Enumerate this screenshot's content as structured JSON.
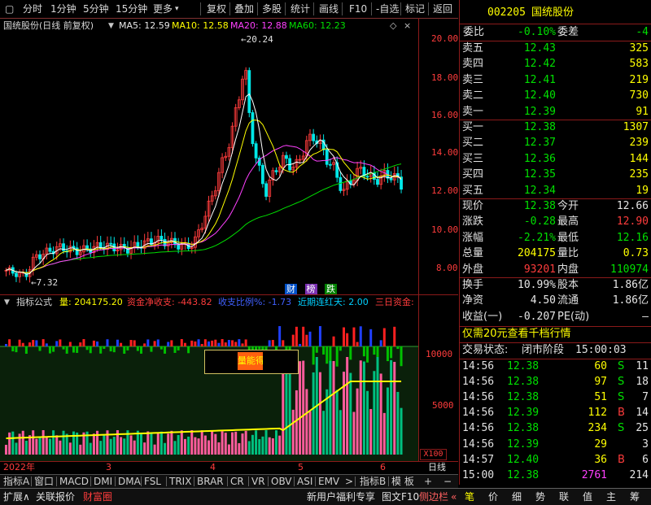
{
  "toolbar": {
    "items": [
      "分时",
      "1分钟",
      "5分钟",
      "15分钟",
      "更多",
      "复权",
      "叠加",
      "多股",
      "统计",
      "画线",
      "F10",
      "-自选",
      "标记",
      "返回"
    ],
    "more_arrow": "▾"
  },
  "price_chart": {
    "title": "国统股份(日线 前复权)",
    "ma5": "MA5: 12.59",
    "ma10": "MA10: 12.58",
    "ma20": "MA20: 12.88",
    "ma60": "MA60: 12.23",
    "high_label": "20.24",
    "low_label": "7.32",
    "y_ticks": [
      "20.00",
      "18.00",
      "16.00",
      "14.00",
      "12.00",
      "10.00",
      "8.00"
    ],
    "badges": [
      "财",
      "榜",
      "跌"
    ],
    "colors": {
      "ma5": "#ffffff",
      "ma10": "#ffff00",
      "ma20": "#ff40ff",
      "ma60": "#00e000",
      "up": "#ff3c3c",
      "down": "#00e8e8"
    }
  },
  "indicator": {
    "title": "指标公式",
    "vol": "量: 204175.20",
    "net": "资金净收支: -443.82",
    "ratio": "收支比例%: -1.73",
    "streak": "近期连红天: 2.00",
    "three_day": "三日资金:",
    "box_label": "量能得",
    "y_ticks": [
      "10000",
      "5000"
    ],
    "scale": "X100"
  },
  "x_axis": {
    "labels": [
      "2022年",
      "3",
      "4",
      "5",
      "6"
    ],
    "period": "日线"
  },
  "tabs": {
    "items": [
      "指标A",
      "窗口",
      "MACD",
      "DMI",
      "DMA",
      "FSL",
      "TRIX",
      "BRAR",
      "CR",
      "VR",
      "OBV",
      "ASI",
      "EMV"
    ],
    "more": ">",
    "right": [
      "指标B",
      "模 板",
      "+",
      "−"
    ]
  },
  "status": {
    "left": [
      "扩展∧",
      "关联报价",
      "财富圈"
    ],
    "mid": [
      "新用户福利专享",
      "图文F10",
      "侧边栏"
    ],
    "tabs": [
      "笔",
      "价",
      "细",
      "势",
      "联",
      "值",
      "主",
      "筹"
    ]
  },
  "quote": {
    "code": "002205",
    "name": "国统股份",
    "wei_bi_label": "委比",
    "wei_bi": "-0.10%",
    "wei_cha_label": "委差",
    "wei_cha": "-4",
    "asks": [
      {
        "label": "卖五",
        "price": "12.43",
        "vol": "325"
      },
      {
        "label": "卖四",
        "price": "12.42",
        "vol": "583"
      },
      {
        "label": "卖三",
        "price": "12.41",
        "vol": "219"
      },
      {
        "label": "卖二",
        "price": "12.40",
        "vol": "730"
      },
      {
        "label": "卖一",
        "price": "12.39",
        "vol": "91"
      }
    ],
    "bids": [
      {
        "label": "买一",
        "price": "12.38",
        "vol": "1307"
      },
      {
        "label": "买二",
        "price": "12.37",
        "vol": "239"
      },
      {
        "label": "买三",
        "price": "12.36",
        "vol": "144"
      },
      {
        "label": "买四",
        "price": "12.35",
        "vol": "235"
      },
      {
        "label": "买五",
        "price": "12.34",
        "vol": "19"
      }
    ],
    "stats": [
      {
        "l1": "现价",
        "v1": "12.38",
        "l2": "今开",
        "v2": "12.66",
        "c1": "green",
        "c2": "white"
      },
      {
        "l1": "涨跌",
        "v1": "-0.28",
        "l2": "最高",
        "v2": "12.90",
        "c1": "green",
        "c2": "red"
      },
      {
        "l1": "涨幅",
        "v1": "-2.21%",
        "l2": "最低",
        "v2": "12.16",
        "c1": "green",
        "c2": "green"
      },
      {
        "l1": "总量",
        "v1": "204175",
        "l2": "量比",
        "v2": "0.73",
        "c1": "yellow",
        "c2": "yellow"
      },
      {
        "l1": "外盘",
        "v1": "93201",
        "l2": "内盘",
        "v2": "110974",
        "c1": "red",
        "c2": "green"
      }
    ],
    "stats2": [
      {
        "l1": "换手",
        "v1": "10.99%",
        "l2": "股本",
        "v2": "1.86亿"
      },
      {
        "l1": "净资",
        "v1": "4.50",
        "l2": "流通",
        "v2": "1.86亿"
      },
      {
        "l1": "收益(一)",
        "v1": "-0.207",
        "l2": "PE(动)",
        "v2": "—"
      }
    ],
    "promo": "仅需20元查看千档行情",
    "trade_status_label": "交易状态:",
    "trade_status": "闭市阶段",
    "trade_time": "15:00:03",
    "ticks": [
      {
        "t": "14:56",
        "p": "12.38",
        "v": "60",
        "s": "S",
        "n": "11",
        "vc": "yellow",
        "sc": "green"
      },
      {
        "t": "14:56",
        "p": "12.38",
        "v": "97",
        "s": "S",
        "n": "18",
        "vc": "yellow",
        "sc": "green"
      },
      {
        "t": "14:56",
        "p": "12.38",
        "v": "51",
        "s": "S",
        "n": "7",
        "vc": "yellow",
        "sc": "green"
      },
      {
        "t": "14:56",
        "p": "12.39",
        "v": "112",
        "s": "B",
        "n": "14",
        "vc": "yellow",
        "sc": "red"
      },
      {
        "t": "14:56",
        "p": "12.38",
        "v": "234",
        "s": "S",
        "n": "25",
        "vc": "yellow",
        "sc": "green"
      },
      {
        "t": "14:56",
        "p": "12.39",
        "v": "29",
        "s": "",
        "n": "3",
        "vc": "yellow",
        "sc": "green"
      },
      {
        "t": "14:57",
        "p": "12.40",
        "v": "36",
        "s": "B",
        "n": "6",
        "vc": "yellow",
        "sc": "red"
      },
      {
        "t": "15:00",
        "p": "12.38",
        "v": "2761",
        "s": "",
        "n": "214",
        "vc": "mag",
        "sc": "green"
      }
    ]
  }
}
